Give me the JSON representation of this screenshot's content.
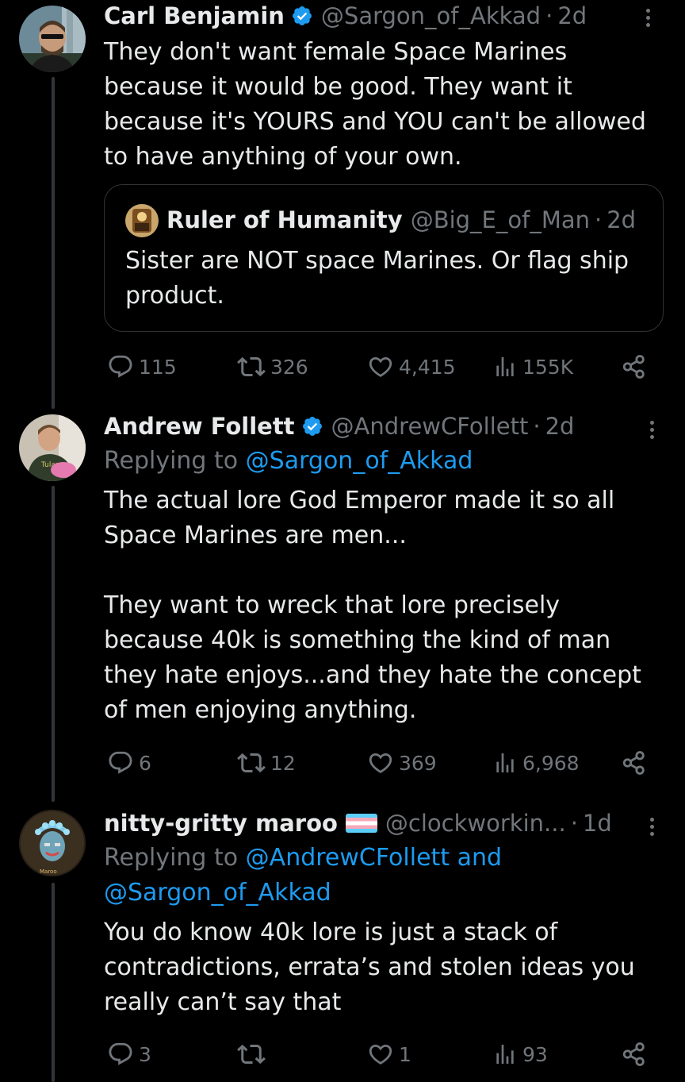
{
  "tweets": [
    {
      "name": "Carl Benjamin",
      "handle": "@Sargon_of_Akkad",
      "time": "2d",
      "text": "They don't want female Space Marines\nbecause it would be good. They want it\nbecause it's YOURS and YOU can't be allowed\nto have anything of your own.",
      "quote": {
        "name": "Ruler of Humanity",
        "handle": "@Big_E_of_Man",
        "time": "2d",
        "text": "Sister are NOT space Marines. Or flag ship\nproduct."
      },
      "replies": "115",
      "reposts": "326",
      "likes": "4,415",
      "views": "155K"
    },
    {
      "name": "Andrew Follett",
      "handle": "@AndrewCFollett",
      "time": "2d",
      "replying_prefix": "Replying to ",
      "replying_to": "@Sargon_of_Akkad",
      "text": "The actual lore God Emperor made it so all\nSpace Marines are men...\n\nThey want to wreck that lore precisely\nbecause 40k is something the kind of man\nthey hate enjoys...and they hate the concept\nof men enjoying anything.",
      "replies": "6",
      "reposts": "12",
      "likes": "369",
      "views": "6,968"
    },
    {
      "name": "nitty-gritty maroo",
      "handle": "@clockworkin...",
      "time": "1d",
      "replying_prefix": "Replying to ",
      "replying_to_line1": "@AndrewCFollett and",
      "replying_to_line2": "@Sargon_of_Akkad",
      "text": "You do know 40k lore is just a stack of\ncontradictions, errata’s and stolen ideas you\nreally can’t say that",
      "replies": "3",
      "reposts": "",
      "likes": "1",
      "views": "93"
    }
  ],
  "colors": {
    "background": "#000000",
    "text": "#e7e9ea",
    "muted": "#71767b",
    "link": "#1d9bf0",
    "verified": "#1d9bf0"
  }
}
